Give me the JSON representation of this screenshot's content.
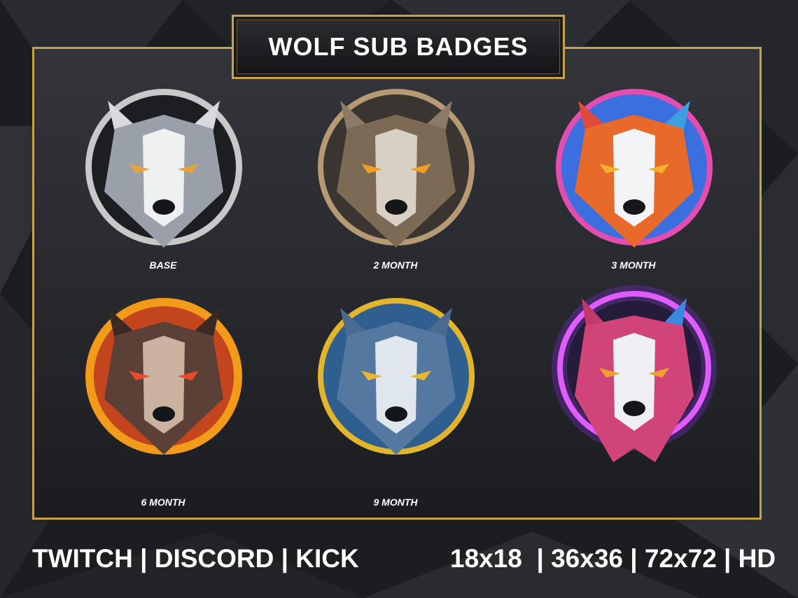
{
  "title": "WOLF SUB BADGES",
  "badges": [
    {
      "label": "BASE",
      "icon": "wolf-icon",
      "ring": "#d9d9d9"
    },
    {
      "label": "2 MONTH",
      "icon": "wolf-icon",
      "ring": "#b59a74"
    },
    {
      "label": "3 MONTH",
      "icon": "wolf-icon",
      "ring": "#e34db0"
    },
    {
      "label": "6 MONTH",
      "icon": "wolf-icon",
      "ring": "#f29a1a"
    },
    {
      "label": "9 MONTH",
      "icon": "wolf-icon",
      "ring": "#e2b52c"
    },
    {
      "label": "",
      "icon": "wolf-icon",
      "ring": "#c445ff"
    }
  ],
  "footer": {
    "platforms": "TWITCH | DISCORD | KICK",
    "sizes": "18x18  | 36x36 | 72x72 | HD"
  },
  "colors": {
    "frame": "#c7a24a",
    "background": "#1b1c1f"
  }
}
